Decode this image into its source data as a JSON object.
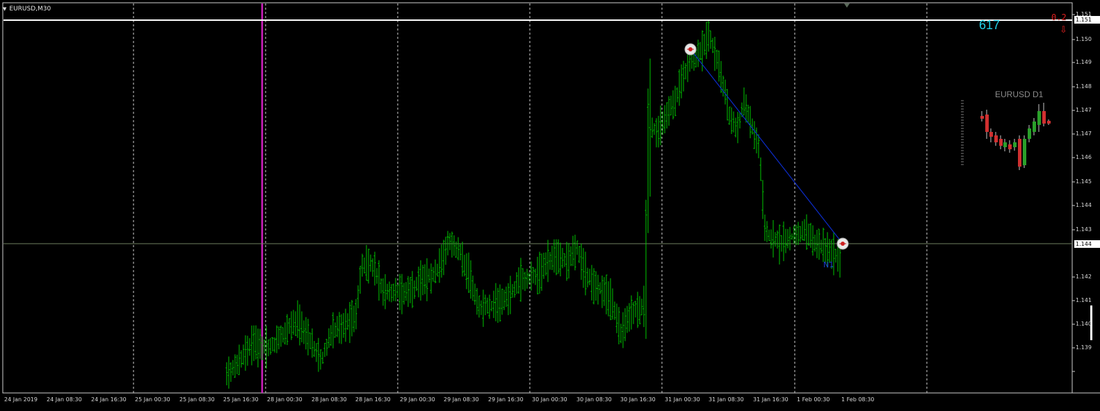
{
  "window": {
    "title": "EURUSD,M30",
    "menu_arrow": "triangle-down-icon"
  },
  "overlay": {
    "counter": "617",
    "mini_chart_title": "EURUSD D1",
    "small_value": "0.2",
    "alert_arrow": "⇩",
    "line_label": "N1"
  },
  "price_axis": {
    "labels": [
      "1.151",
      "1.150",
      "1.149",
      "1.148",
      "1.147",
      "1.147",
      "1.146",
      "1.145",
      "1.144",
      "1.143",
      "1.142",
      "1.141",
      "1.140",
      "1.139"
    ],
    "horizontal_line_label": "1.151",
    "current_price_label": "1.144"
  },
  "time_axis": {
    "labels": [
      "24 Jan 2019",
      "24 Jan 08:30",
      "24 Jan 16:30",
      "25 Jan 00:30",
      "25 Jan 08:30",
      "25 Jan 16:30",
      "28 Jan 00:30",
      "28 Jan 08:30",
      "28 Jan 16:30",
      "29 Jan 00:30",
      "29 Jan 08:30",
      "29 Jan 16:30",
      "30 Jan 00:30",
      "30 Jan 08:30",
      "30 Jan 16:30",
      "31 Jan 00:30",
      "31 Jan 08:30",
      "31 Jan 16:30",
      "1 Feb 00:30",
      "1 Feb 08:30"
    ]
  },
  "colors": {
    "background": "#000000",
    "bars": "#00c800",
    "grid": "#d0d0d0",
    "period_separator": "#d020c0",
    "trendline": "#0c2cc8",
    "horizontal_line": "#ffffff",
    "crosshair": "#6f7f5f",
    "bull_candle": "#2aa02a",
    "bear_candle": "#d03030"
  }
}
